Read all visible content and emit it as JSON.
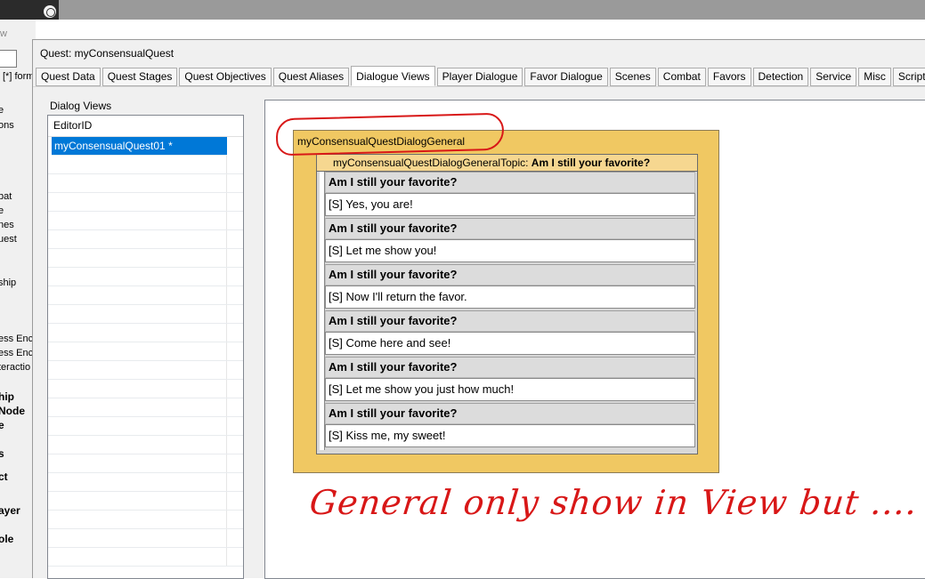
{
  "behind_app": {
    "window_suffix": "w",
    "form_label": "[*] form",
    "list": [
      {
        "text": "e",
        "bold": false
      },
      {
        "text": "ons",
        "bold": false
      },
      {
        "text": "bat",
        "bold": false
      },
      {
        "text": "e",
        "bold": false
      },
      {
        "text": "nes",
        "bold": false
      },
      {
        "text": "uest",
        "bold": false
      },
      {
        "text": "ship",
        "bold": false
      },
      {
        "text": "ess Enc",
        "bold": false
      },
      {
        "text": "ess Enc",
        "bold": false
      },
      {
        "text": "teractio",
        "bold": false
      },
      {
        "text": "hip",
        "bold": true
      },
      {
        "text": "Node",
        "bold": true
      },
      {
        "text": "e",
        "bold": true
      },
      {
        "text": "s",
        "bold": true
      },
      {
        "text": "ct",
        "bold": true
      },
      {
        "text": "ayer",
        "bold": true
      },
      {
        "text": "ole",
        "bold": true
      }
    ]
  },
  "window": {
    "title": "Quest: myConsensualQuest",
    "tabs": [
      "Quest Data",
      "Quest Stages",
      "Quest Objectives",
      "Quest Aliases",
      "Dialogue Views",
      "Player Dialogue",
      "Favor Dialogue",
      "Scenes",
      "Combat",
      "Favors",
      "Detection",
      "Service",
      "Misc",
      "Scripts"
    ],
    "active_tab": "Dialogue Views"
  },
  "dialog_views": {
    "label": "Dialog Views",
    "column_header": "EditorID",
    "items": [
      "myConsensualQuest01 *"
    ]
  },
  "branch": {
    "title": "myConsensualQuestDialogGeneral",
    "topic_prefix": "myConsensualQuestDialogGeneralTopic:",
    "topic_text": "Am I still your favorite?",
    "responses": [
      {
        "prompt": "Am I still your favorite?",
        "response": "[S] Yes, you are!"
      },
      {
        "prompt": "Am I still your favorite?",
        "response": "[S] Let me show you!"
      },
      {
        "prompt": "Am I still your favorite?",
        "response": "[S] Now I'll return the favor."
      },
      {
        "prompt": "Am I still your favorite?",
        "response": "[S] Come here and see!"
      },
      {
        "prompt": "Am I still your favorite?",
        "response": "[S] Let me show you just how much!"
      },
      {
        "prompt": "Am I still your favorite?",
        "response": "[S] Kiss me, my sweet!"
      }
    ]
  },
  "annotation": {
    "text": "General only show in View  but ....",
    "color": "#d81717"
  },
  "colors": {
    "branch_bg": "#f0c862",
    "selection": "#0078d7"
  }
}
